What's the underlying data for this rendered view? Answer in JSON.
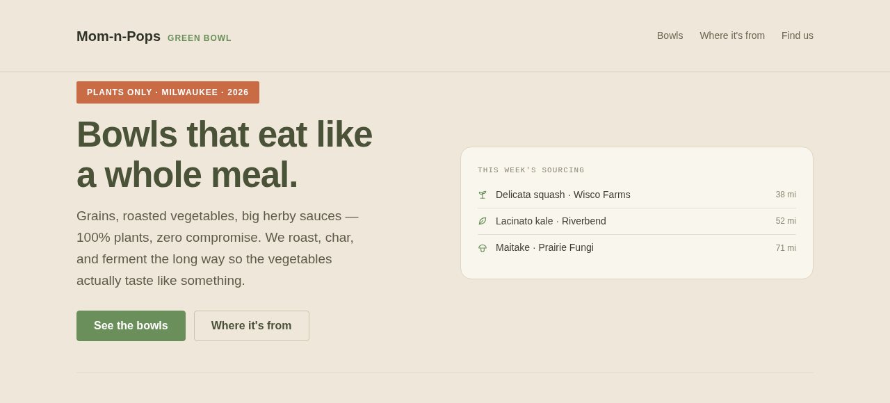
{
  "header": {
    "brand": "Mom-n-Pops",
    "tagline": "GREEN BOWL",
    "nav": [
      "Bowls",
      "Where it's from",
      "Find us"
    ]
  },
  "hero": {
    "badge": "PLANTS ONLY · MILWAUKEE · 2026",
    "headline_lines": [
      "Bowls that eat like",
      "a whole meal."
    ],
    "body": "Grains, roasted vegetables, big herby sauces — 100% plants, zero compromise. We roast, char, and ferment the long way so the vegetables actually taste like something.",
    "buttons": [
      {
        "label": "See the bowls",
        "kind": "primary"
      },
      {
        "label": "Where it's from",
        "kind": "secondary"
      }
    ]
  },
  "sourcing": {
    "title": "THIS WEEK'S SOURCING",
    "items": [
      {
        "kind": "sprout",
        "name": "Delicata squash · Wisco Farms",
        "distance": "38 mi"
      },
      {
        "kind": "leaf",
        "name": "Lacinato kale · Riverbend",
        "distance": "52 mi"
      },
      {
        "kind": "mushroom",
        "name": "Maitake · Prairie Fungi",
        "distance": "71 mi"
      }
    ]
  }
}
